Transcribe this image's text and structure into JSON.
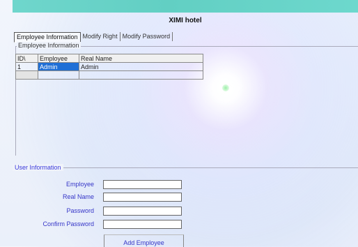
{
  "window": {
    "title": "XIMI hotel"
  },
  "tabs": [
    {
      "label": "Employee Information",
      "active": true
    },
    {
      "label": "Modify Right",
      "active": false
    },
    {
      "label": "Modify Password",
      "active": false
    }
  ],
  "employee_group": {
    "label": "Employee Information",
    "columns": [
      "ID\\",
      "Employee",
      "Real Name"
    ],
    "rows": [
      {
        "id": "1",
        "employee": "Admin",
        "real_name": "Admin"
      }
    ]
  },
  "user_info": {
    "label": "User Information",
    "fields": {
      "employee": {
        "label": "Employee",
        "value": ""
      },
      "real_name": {
        "label": "Real Name",
        "value": ""
      },
      "password": {
        "label": "Password",
        "value": ""
      },
      "confirm_password": {
        "label": "Confirm Password",
        "value": ""
      }
    },
    "add_button": "Add Employee"
  },
  "colors": {
    "title_band": "#62cfc3",
    "label_text": "#3535c8",
    "selection": "#1f6fd6"
  }
}
